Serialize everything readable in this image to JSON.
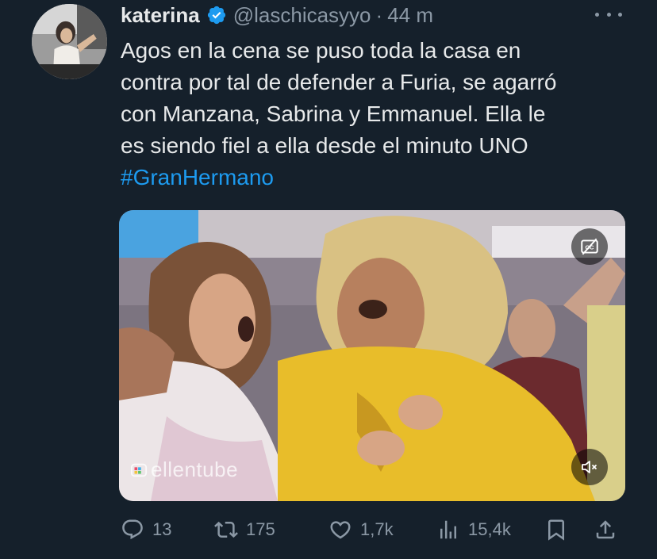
{
  "tweet": {
    "author": {
      "display_name": "katerina",
      "handle": "@laschicasyyo",
      "separator": "·",
      "time": "44 m",
      "verified": true
    },
    "text_lines": [
      "Agos en la cena se puso toda la casa en",
      "contra por tal de defender a Furia, se agarró",
      "con Manzana, Sabrina y Emmanuel. Ella le",
      "es siendo fiel a ella desde el minuto UNO"
    ],
    "hashtag": "#GranHermano",
    "media": {
      "watermark": "ellentube",
      "cc_icon": "captions-off-icon",
      "mute_icon": "speaker-muted-icon"
    },
    "stats": {
      "replies": "13",
      "retweets": "175",
      "likes": "1,7k",
      "views": "15,4k"
    }
  },
  "colors": {
    "background": "#15202b",
    "text": "#e7e9ea",
    "muted": "#8b98a5",
    "accent": "#1d9bf0"
  }
}
